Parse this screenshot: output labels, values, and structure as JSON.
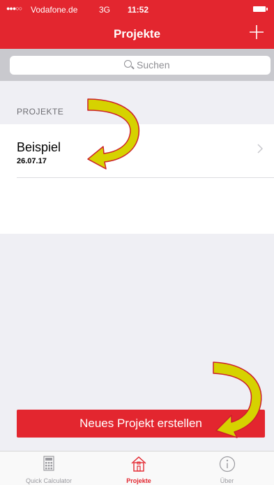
{
  "status_bar": {
    "signal": "●●●○○",
    "carrier": "Vodafone.de",
    "network": "3G",
    "time": "11:52"
  },
  "nav": {
    "title": "Projekte",
    "add_icon": "plus-icon"
  },
  "search": {
    "placeholder": "Suchen",
    "icon": "search-icon"
  },
  "section": {
    "header": "PROJEKTE"
  },
  "projects": [
    {
      "name": "Beispiel",
      "date": "26.07.17"
    }
  ],
  "new_project_button": "Neues Projekt erstellen",
  "tabbar": {
    "tabs": [
      {
        "label": "Quick Calculator",
        "icon": "calculator-icon",
        "active": false
      },
      {
        "label": "Projekte",
        "icon": "house-icon",
        "active": true
      },
      {
        "label": "Über",
        "icon": "info-icon",
        "active": false
      }
    ]
  },
  "colors": {
    "brand_red": "#e3262f",
    "annotation_arrow_fill": "#d6d200",
    "annotation_arrow_stroke": "#cc1f2b"
  }
}
